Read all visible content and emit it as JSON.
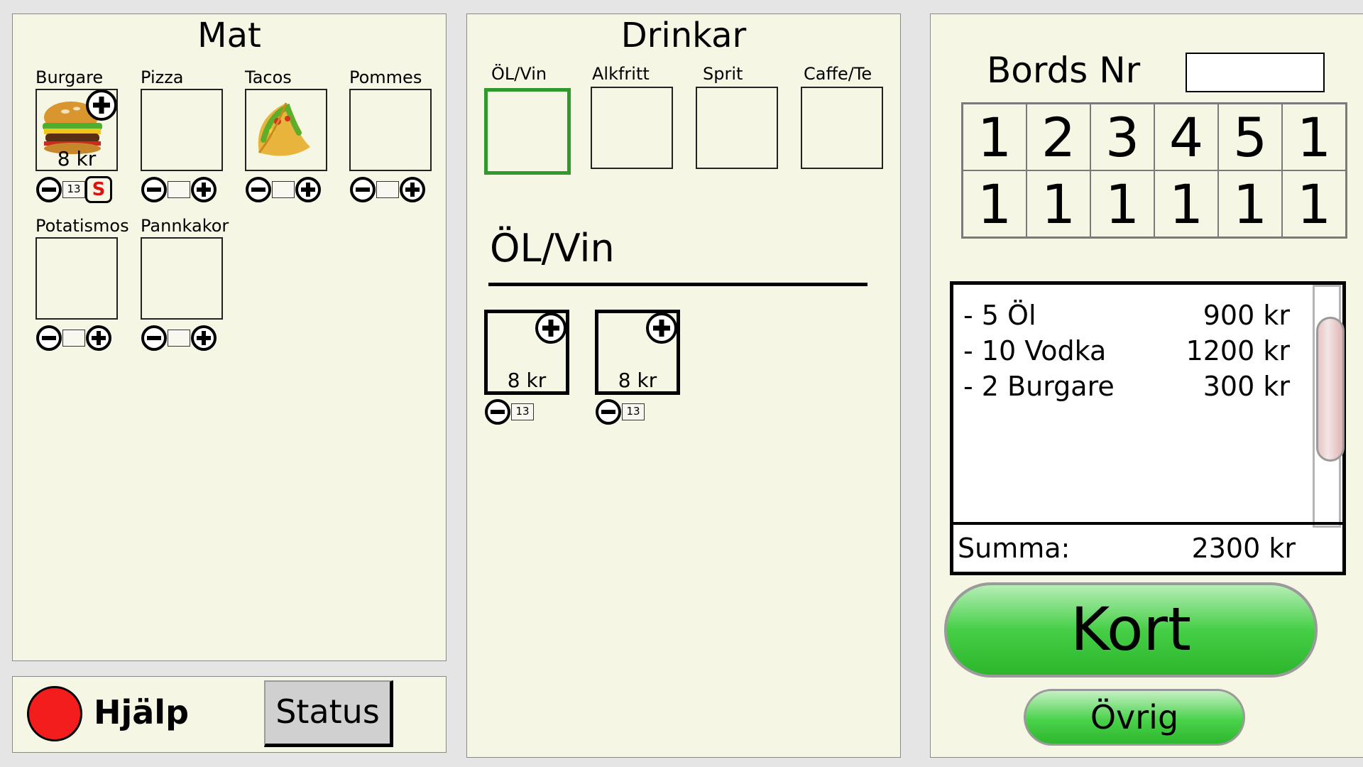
{
  "food": {
    "title": "Mat",
    "items": [
      {
        "label": "Burgare",
        "image": "burger-image",
        "price": "8 kr",
        "qty": "13",
        "special": "S"
      },
      {
        "label": "Pizza"
      },
      {
        "label": "Tacos",
        "image": "taco-image"
      },
      {
        "label": "Pommes"
      },
      {
        "label": "Potatismos"
      },
      {
        "label": "Pannkakor"
      }
    ]
  },
  "drinks": {
    "title": "Drinkar",
    "categories": [
      "ÖL/Vin",
      "Alkfritt",
      "Sprit",
      "Caffe/Te"
    ],
    "selected_category": "ÖL/Vin",
    "section_heading": "ÖL/Vin",
    "items": [
      {
        "price": "8 kr",
        "qty": "13"
      },
      {
        "price": "8 kr",
        "qty": "13"
      }
    ]
  },
  "table": {
    "label": "Bords Nr",
    "input_value": "",
    "numbers": [
      [
        "1",
        "2",
        "3",
        "4",
        "5",
        "1"
      ],
      [
        "1",
        "1",
        "1",
        "1",
        "1",
        "1"
      ]
    ]
  },
  "order": {
    "lines": [
      {
        "name": "- 5 Öl",
        "amount": "900 kr"
      },
      {
        "name": "- 10 Vodka",
        "amount": "1200 kr"
      },
      {
        "name": "- 2 Burgare",
        "amount": "300 kr"
      }
    ],
    "summa_label": "Summa:",
    "summa_value": "2300 kr"
  },
  "buttons": {
    "kort": "Kort",
    "ovrig": "Övrig",
    "status": "Status",
    "help": "Hjälp"
  },
  "colors": {
    "panel_bg": "#f5f6e4",
    "selected_border": "#2e9a2e",
    "help_dot": "#f31d1d",
    "green_button": "#2cb62c"
  },
  "icons": {
    "plus": "plus-circle-icon",
    "minus": "minus-circle-icon"
  }
}
